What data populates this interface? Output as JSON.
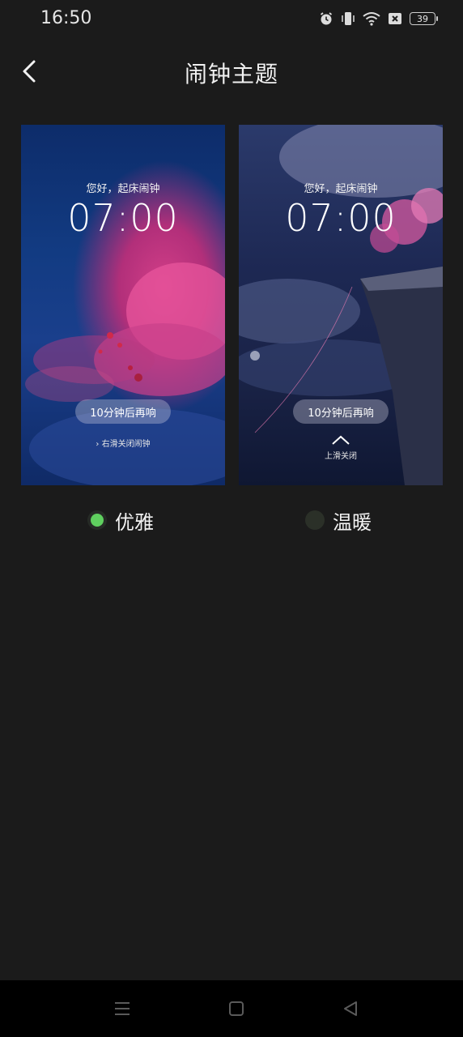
{
  "status_bar": {
    "time": "16:50",
    "battery_level": "39",
    "icons": [
      "alarm-icon",
      "vibrate-icon",
      "wifi-icon",
      "sim-x-icon",
      "battery-icon"
    ]
  },
  "header": {
    "title": "闹钟主题"
  },
  "themes": [
    {
      "greeting": "您好，起床闹钟",
      "time": "07:00",
      "snooze": "10分钟后再响",
      "dismiss": "右滑关闭闹钟",
      "label": "优雅",
      "selected": true
    },
    {
      "greeting": "您好，起床闹钟",
      "time": "07:00",
      "snooze": "10分钟后再响",
      "dismiss": "上滑关闭",
      "label": "温暖",
      "selected": false
    }
  ],
  "colors": {
    "background": "#1b1b1b",
    "selected_radio": "#5fd05f",
    "nav_bar": "#000000"
  },
  "nav": [
    "menu-icon",
    "home-icon",
    "back-triangle-icon"
  ]
}
